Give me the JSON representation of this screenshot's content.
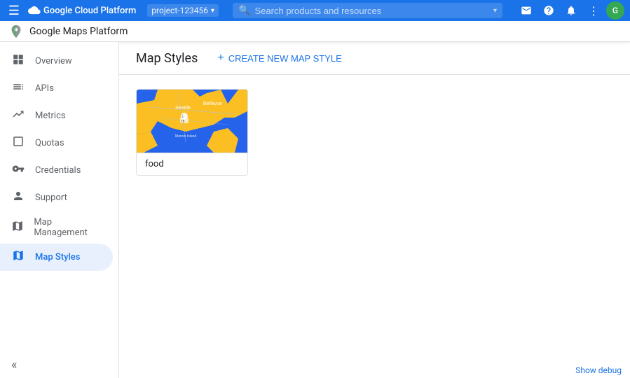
{
  "topbar": {
    "title": "Google Cloud Platform",
    "menu_icon": "☰",
    "project_name": "project-123456",
    "search_placeholder": "Search products and resources",
    "icons": {
      "email": "✉",
      "help": "?",
      "bell": "🔔",
      "more": "⋮",
      "avatar_text": "G"
    }
  },
  "secondbar": {
    "title": "Google Maps Platform"
  },
  "sidebar": {
    "items": [
      {
        "id": "overview",
        "label": "Overview",
        "icon": "⊞",
        "active": false
      },
      {
        "id": "apis",
        "label": "APIs",
        "icon": "≡",
        "active": false
      },
      {
        "id": "metrics",
        "label": "Metrics",
        "icon": "📊",
        "active": false
      },
      {
        "id": "quotas",
        "label": "Quotas",
        "icon": "⬜",
        "active": false
      },
      {
        "id": "credentials",
        "label": "Credentials",
        "icon": "🔑",
        "active": false
      },
      {
        "id": "support",
        "label": "Support",
        "icon": "👤",
        "active": false
      },
      {
        "id": "map-management",
        "label": "Map Management",
        "icon": "⊟",
        "active": false
      },
      {
        "id": "map-styles",
        "label": "Map Styles",
        "icon": "🗺",
        "active": true
      }
    ],
    "collapse_icon": "«"
  },
  "content": {
    "header": {
      "page_title": "Map Styles",
      "create_btn_label": "CREATE NEW MAP STYLE",
      "create_btn_icon": "+"
    },
    "cards": [
      {
        "id": "food-map",
        "label": "food",
        "thumbnail_alt": "Seattle area map with blue and yellow styling"
      }
    ]
  },
  "debug": {
    "label": "Show debug"
  }
}
